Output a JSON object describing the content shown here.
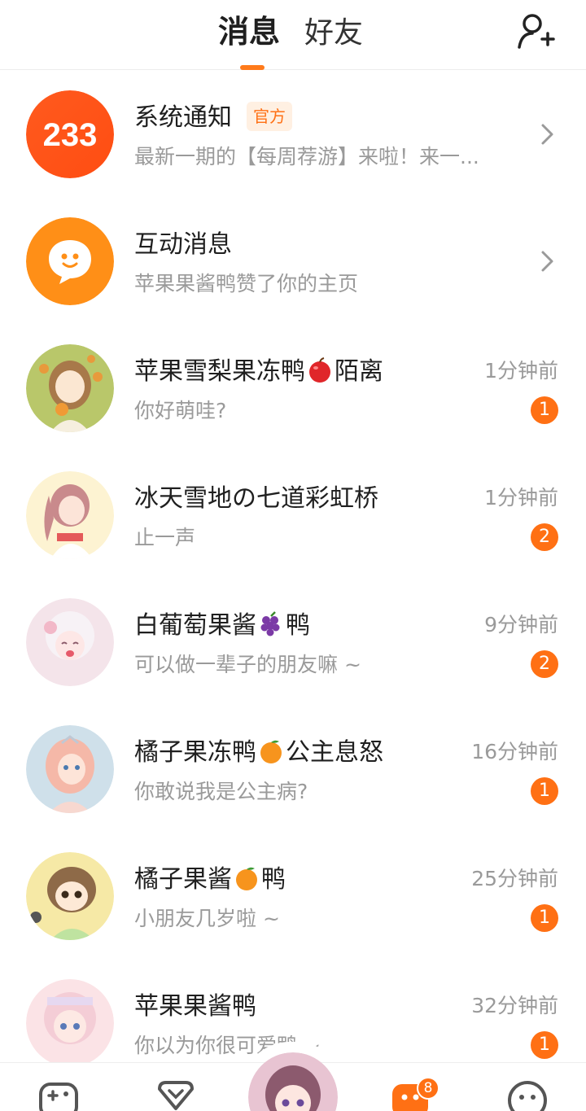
{
  "header": {
    "tab_messages": "消息",
    "tab_friends": "好友",
    "accent_color": "#ff7014"
  },
  "system": {
    "logo_text": "233",
    "title": "系统通知",
    "tag": "官方",
    "subtitle": "最新一期的【每周荐游】来啦！来一..."
  },
  "interaction": {
    "title": "互动消息",
    "subtitle": "苹果果酱鸭赞了你的主页"
  },
  "chats": [
    {
      "name_a": "苹果雪梨果冻鸭",
      "emoji": "apple-emoji",
      "name_b": "陌离",
      "message": "你好萌哇?",
      "time": "1分钟前",
      "unread": "1"
    },
    {
      "name_a": "冰天雪地の七道彩虹桥",
      "emoji": "",
      "name_b": "",
      "message": "止一声",
      "time": "1分钟前",
      "unread": "2"
    },
    {
      "name_a": "白葡萄果酱",
      "emoji": "grape-emoji",
      "name_b": "鸭",
      "message": "可以做一辈子的朋友嘛 ~",
      "time": "9分钟前",
      "unread": "2"
    },
    {
      "name_a": "橘子果冻鸭",
      "emoji": "orange-emoji",
      "name_b": "公主息怒",
      "message": "你敢说我是公主病?",
      "time": "16分钟前",
      "unread": "1"
    },
    {
      "name_a": "橘子果酱",
      "emoji": "orange-emoji",
      "name_b": "鸭",
      "message": "小朋友几岁啦 ~",
      "time": "25分钟前",
      "unread": "1"
    },
    {
      "name_a": "苹果果酱鸭",
      "emoji": "",
      "name_b": "",
      "message": "你以为你很可爱鸭 ~",
      "time": "32分钟前",
      "unread": "1"
    }
  ],
  "bottom_nav": {
    "items": [
      "game-icon",
      "gift-icon",
      "center-avatar",
      "message-icon",
      "profile-icon"
    ],
    "message_badge": "8"
  }
}
